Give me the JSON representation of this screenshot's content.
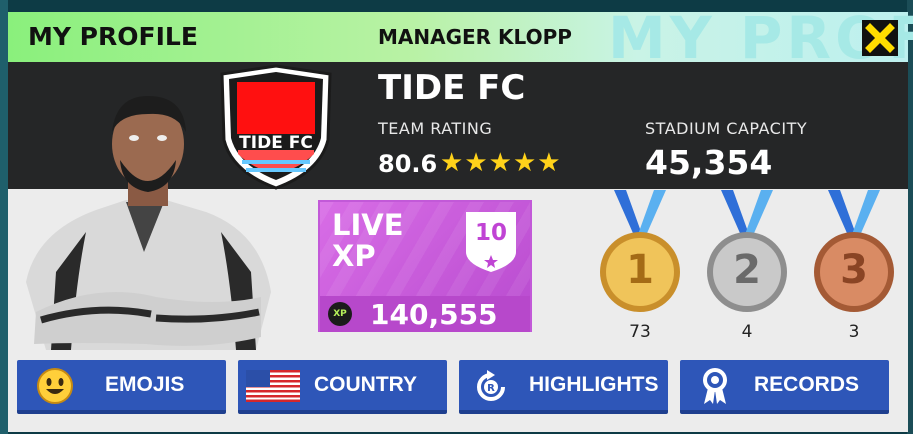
{
  "header": {
    "title": "MY PROFILE",
    "manager": "MANAGER KLOPP",
    "watermark": "MY PROFI",
    "close_icon": "close-x-icon"
  },
  "team": {
    "name": "TIDE FC",
    "badge_text": "TIDE FC",
    "rating_label": "TEAM RATING",
    "rating_value": "80.6",
    "stars": 5,
    "capacity_label": "STADIUM CAPACITY",
    "capacity_value": "45,354"
  },
  "xp": {
    "title": "LIVE XP",
    "level": "10",
    "badge": "XP",
    "value": "140,555"
  },
  "medals": [
    {
      "rank": "1",
      "count": "73",
      "type": "gold"
    },
    {
      "rank": "2",
      "count": "4",
      "type": "silver"
    },
    {
      "rank": "3",
      "count": "3",
      "type": "bronze"
    }
  ],
  "buttons": [
    {
      "label": "EMOJIS",
      "icon": "smiley-icon"
    },
    {
      "label": "COUNTRY",
      "icon": "us-flag-icon"
    },
    {
      "label": "HIGHLIGHTS",
      "icon": "replay-icon"
    },
    {
      "label": "RECORDS",
      "icon": "rosette-icon"
    }
  ],
  "colors": {
    "header_green": "#8af07c",
    "dark_band": "#252627",
    "button_blue": "#2e56b8",
    "xp_purple": "#c95bdc",
    "star_yellow": "#ffd21a"
  }
}
